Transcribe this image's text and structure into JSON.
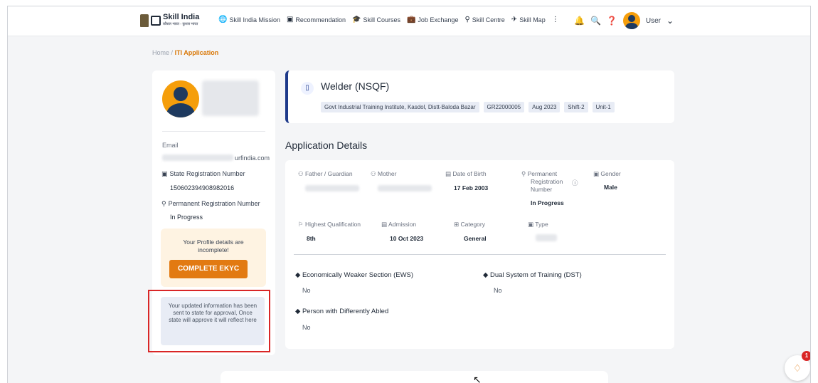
{
  "header": {
    "logo_text": "Skill India",
    "logo_sub": "कौशल भारत - कुशल भारत",
    "nav": [
      {
        "label": "Skill India Mission",
        "icon": "globe-icon",
        "glyph": "🌐"
      },
      {
        "label": "Recommendation",
        "icon": "message-icon",
        "glyph": "▣"
      },
      {
        "label": "Skill Courses",
        "icon": "graduation-cap-icon",
        "glyph": "🎓"
      },
      {
        "label": "Job Exchange",
        "icon": "briefcase-icon",
        "glyph": "💼"
      },
      {
        "label": "Skill Centre",
        "icon": "location-pin-icon",
        "glyph": "⚲"
      },
      {
        "label": "Skill Map",
        "icon": "map-icon",
        "glyph": "✈"
      }
    ],
    "more_glyph": "⋮",
    "user_label": "User"
  },
  "breadcrumb": {
    "home": "Home",
    "separator": "/",
    "current": "ITI Application"
  },
  "profile": {
    "email_label": "Email",
    "email_value": "urfindia.com",
    "state_reg_label": "State Registration Number",
    "state_reg_value": "150602394908982016",
    "perm_reg_label": "Permanent Registration Number",
    "perm_reg_value": "In Progress",
    "ekyc_text": "Your Profile details are incomplete!",
    "ekyc_button": "COMPLETE EKYC",
    "notice_text": "Your updated information has been sent to state for approval, Once state will approve it will reflect here"
  },
  "course": {
    "title": "Welder (NSQF)",
    "chips": [
      "Govt Industrial Training Institute, Kasdol, Distt-Baloda Bazar",
      "GR22000005",
      "Aug 2023",
      "Shift-2",
      "Unit-1"
    ]
  },
  "details": {
    "section_title": "Application Details",
    "father_label": "Father / Guardian",
    "mother_label": "Mother",
    "dob_label": "Date of Birth",
    "dob_value": "17 Feb 2003",
    "prn_label_1": "Permanent",
    "prn_label_2": "Registration",
    "prn_label_3": "Number",
    "prn_value": "In Progress",
    "gender_label": "Gender",
    "gender_value": "Male",
    "qual_label": "Highest Qualification",
    "qual_value": "8th",
    "admission_label": "Admission",
    "admission_value": "10 Oct 2023",
    "category_label": "Category",
    "category_value": "General",
    "type_label": "Type",
    "ews_label": "Economically Weaker Section (EWS)",
    "ews_value": "No",
    "dst_label": "Dual System of Training (DST)",
    "dst_value": "No",
    "pwd_label": "Person with Differently Abled",
    "pwd_value": "No"
  },
  "chat": {
    "badge": "1"
  }
}
